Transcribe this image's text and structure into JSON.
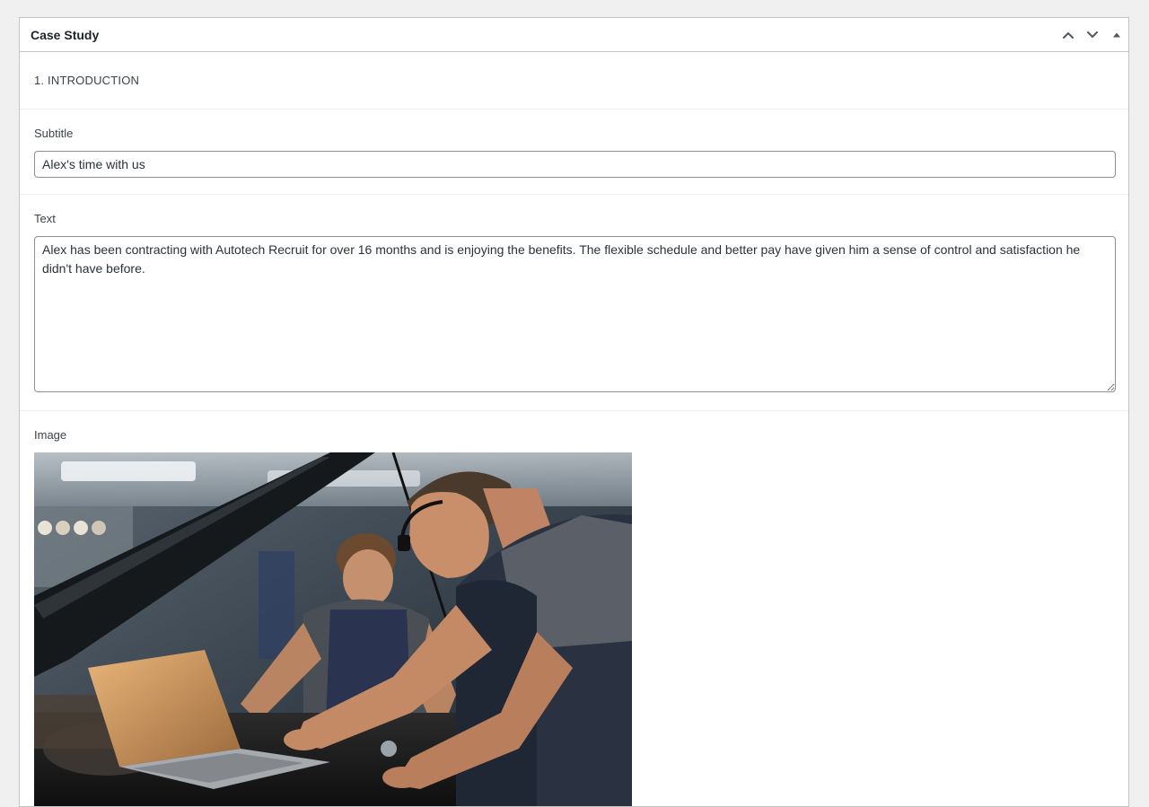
{
  "metabox": {
    "title": "Case Study",
    "controls": {
      "move_up": "chevron-up-icon",
      "move_down": "chevron-down-icon",
      "toggle": "triangle-up-icon"
    }
  },
  "intro": {
    "heading": "1. INTRODUCTION"
  },
  "fields": {
    "subtitle": {
      "label": "Subtitle",
      "value": "Alex's time with us"
    },
    "text": {
      "label": "Text",
      "value": "Alex has been contracting with Autotech Recruit for over 16 months and is enjoying the benefits. The flexible schedule and better pay have given him a sense of control and satisfaction he didn't have before."
    },
    "image": {
      "label": "Image",
      "subject": "photo-two-mechanics-laptop"
    }
  },
  "colors": {
    "page_bg": "#f0f0f1",
    "panel_border": "#c3c4c7",
    "input_border": "#8c8f94",
    "text": "#1d2327"
  }
}
